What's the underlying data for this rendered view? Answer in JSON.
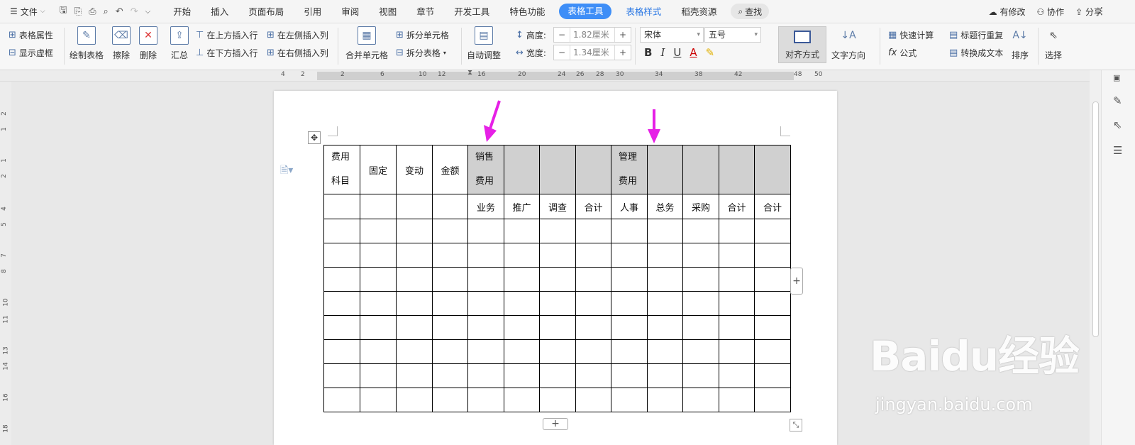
{
  "menubar": {
    "file_label": "文件",
    "tabs": [
      "开始",
      "插入",
      "页面布局",
      "引用",
      "审阅",
      "视图",
      "章节",
      "开发工具",
      "特色功能"
    ],
    "active_tab": "表格工具",
    "extra_tabs": [
      "表格样式",
      "稻壳资源"
    ],
    "search_label": "查找",
    "right": {
      "modified": "有修改",
      "collab": "协作",
      "share": "分享"
    }
  },
  "ribbon": {
    "table_props": "表格属性",
    "show_gridlines": "显示虚框",
    "draw_table": "绘制表格",
    "erase": "擦除",
    "delete": "删除",
    "summary": "汇总",
    "insert_row_above": "在上方插入行",
    "insert_row_below": "在下方插入行",
    "insert_col_left": "在左侧插入列",
    "insert_col_right": "在右侧插入列",
    "merge_cells": "合并单元格",
    "split_cells": "拆分单元格",
    "split_table": "拆分表格",
    "auto_fit": "自动调整",
    "height_label": "高度:",
    "height_value": "1.82厘米",
    "width_label": "宽度:",
    "width_value": "1.34厘米",
    "font_name": "宋体",
    "font_size": "五号",
    "align": "对齐方式",
    "text_direction": "文字方向",
    "quick_calc": "快速计算",
    "repeat_title": "标题行重复",
    "formula": "公式",
    "to_text": "转换成文本",
    "sort": "排序",
    "select": "选择"
  },
  "ruler_marks": [
    "4",
    "2",
    "2",
    "6",
    "10",
    "12",
    "16",
    "20",
    "24",
    "26",
    "28",
    "30",
    "34",
    "38",
    "42",
    "48",
    "50"
  ],
  "vruler_marks": [
    "2",
    "1",
    "1",
    "2",
    "4",
    "5",
    "7",
    "8",
    "10",
    "11",
    "13",
    "14",
    "16",
    "18"
  ],
  "table": {
    "header_row1": [
      "费用\n科目",
      "固定",
      "变动",
      "金额",
      "销售\n费用",
      "",
      "",
      "",
      "管理\n费用",
      "",
      "",
      "",
      ""
    ],
    "header_row2": [
      "",
      "",
      "",
      "",
      "业务",
      "推广",
      "调查",
      "合计",
      "人事",
      "总务",
      "采购",
      "合计",
      "合计"
    ],
    "empty_rows": 8
  },
  "watermark": {
    "brand": "Baidu经验",
    "url": "jingyan.baidu.com"
  },
  "colors": {
    "accent": "#3e8ef7",
    "arrow": "#e620e6",
    "header_fill": "#d0d0d0"
  }
}
